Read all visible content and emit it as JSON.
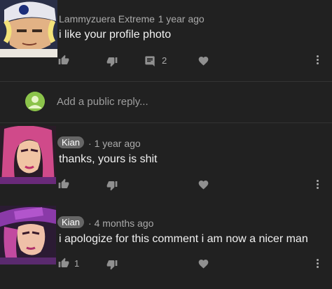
{
  "comment_1": {
    "author": "Lammyzuera Extreme",
    "age": "1 year ago",
    "text": "i like your profile photo",
    "reply_count": "2"
  },
  "reply_box": {
    "placeholder": "Add a public reply..."
  },
  "comment_2": {
    "author": "Kian",
    "age": "1 year ago",
    "text": "thanks, yours is shit"
  },
  "comment_3": {
    "author": "Kian",
    "age": "4 months ago",
    "text": "i apologize for this comment i am now a nicer man",
    "like_count": "1"
  },
  "colors": {
    "background": "#212121",
    "text": "#f1f1f1",
    "secondary": "#aaaaaa",
    "author_chip": "#666666",
    "avatar_green": "#8bc34a"
  }
}
